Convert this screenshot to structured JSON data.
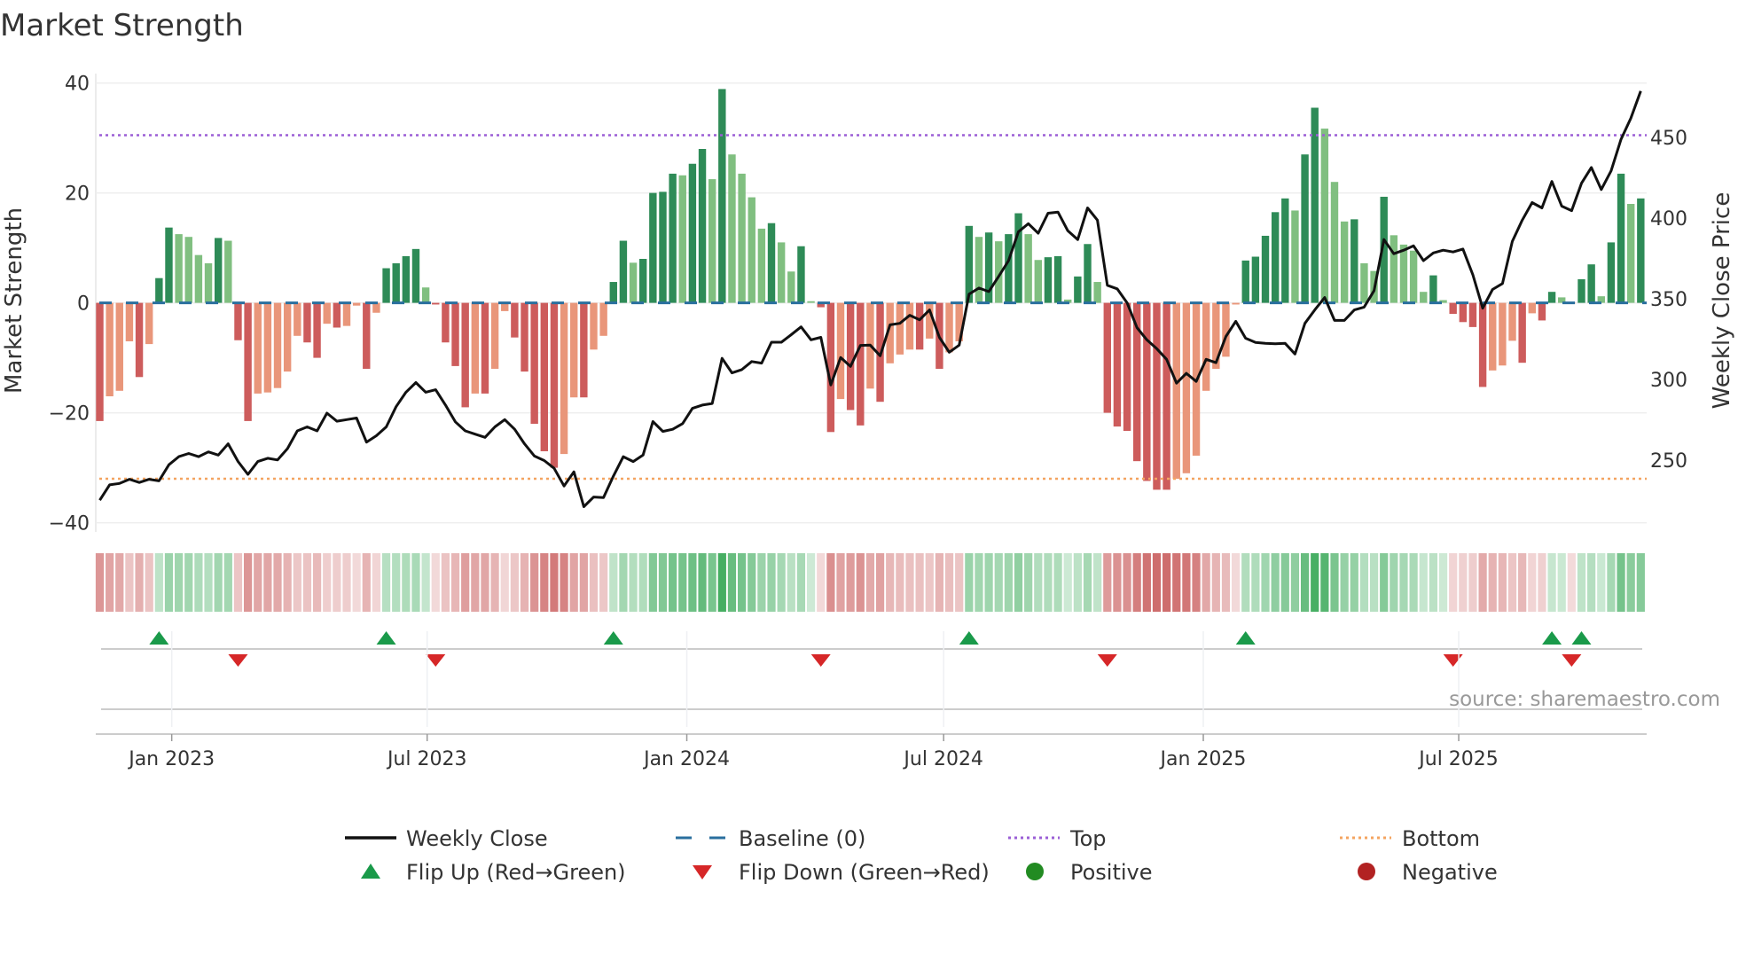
{
  "chart_data": {
    "type": "bar",
    "title": "Market Strength",
    "ylabel": "Market Strength",
    "y2label": "Weekly Close Price",
    "ylim": [
      -42,
      42
    ],
    "yticks": [
      "40",
      "20",
      "0",
      "−20",
      "−40"
    ],
    "ytick_values": [
      40,
      20,
      0,
      -20,
      -40
    ],
    "y2ticks": [
      "450",
      "400",
      "350",
      "300",
      "250"
    ],
    "y2tick_values": [
      450,
      400,
      350,
      300,
      250
    ],
    "x_start": "2022-11-11",
    "x_step_days": 7,
    "xticks": [
      {
        "label": "Jan 2023",
        "date": "2023-01-01"
      },
      {
        "label": "Jul 2023",
        "date": "2023-07-01"
      },
      {
        "label": "Jan 2024",
        "date": "2024-01-01"
      },
      {
        "label": "Jul 2024",
        "date": "2024-07-01"
      },
      {
        "label": "Jan 2025",
        "date": "2025-01-01"
      },
      {
        "label": "Jul 2025",
        "date": "2025-07-01"
      }
    ],
    "top_level": 30.5,
    "bottom_level": -32,
    "baseline": 0,
    "strength": [
      -21.5,
      -17,
      -16,
      -7,
      -13.5,
      -7.5,
      4.5,
      13.7,
      12.5,
      12,
      8.7,
      7.2,
      11.8,
      11.3,
      -6.8,
      -21.5,
      -16.5,
      -16.3,
      -15.5,
      -12.5,
      -6,
      -7.2,
      -10,
      -3.8,
      -4.5,
      -4.2,
      -0.5,
      -12,
      -1.8,
      6.3,
      7.2,
      8.5,
      9.8,
      2.8,
      -0.3,
      -7.2,
      -11.5,
      -19,
      -16.5,
      -16.5,
      -12,
      -1.5,
      -6.3,
      -12.5,
      -22,
      -27,
      -30,
      -27.5,
      -17.2,
      -17.2,
      -8.5,
      -6,
      3.8,
      11.3,
      7.3,
      8,
      20,
      20.2,
      23.5,
      23.2,
      25.3,
      28,
      22.5,
      38.9,
      27,
      23.5,
      19.2,
      13.5,
      14.5,
      11,
      5.7,
      10.3,
      0.3,
      -0.8,
      -23.5,
      -17.5,
      -19.5,
      -22.3,
      -15.6,
      -18,
      -11,
      -9.4,
      -8.5,
      -8.5,
      -6.5,
      -12,
      -9,
      -7,
      14,
      12,
      12.8,
      11.2,
      12.5,
      16.3,
      12.5,
      7.8,
      8.3,
      8.5,
      0.6,
      4.8,
      10.7,
      3.8,
      -20,
      -22.5,
      -23.3,
      -28.8,
      -32.4,
      -34,
      -34,
      -32,
      -31,
      -27.8,
      -16,
      -12,
      -9.8,
      -0.3,
      7.7,
      8.4,
      12.2,
      16.5,
      19,
      16.8,
      27,
      35.5,
      31.7,
      22,
      14.8,
      15.2,
      7.2,
      5.8,
      19.3,
      12.3,
      10.6,
      9.5,
      2,
      5,
      0.5,
      -2,
      -3.5,
      -4.4,
      -15.3,
      -12.3,
      -11.4,
      -6.9,
      -10.9,
      -1.9,
      -3.2,
      2,
      1,
      -0.1,
      4.3,
      7,
      1.2,
      11,
      23.5,
      18,
      19
    ],
    "weekly_close": [
      225,
      234.5,
      235.4,
      238,
      236,
      238,
      237,
      247,
      252,
      254,
      252,
      255,
      253,
      260,
      249,
      241,
      249,
      251,
      250,
      257,
      268,
      270.5,
      268,
      279,
      274,
      275,
      276,
      261,
      265,
      270.5,
      283,
      292,
      298,
      292,
      293.5,
      284,
      273.6,
      268,
      266,
      264,
      270.5,
      275,
      269,
      260,
      252.4,
      249.6,
      244.8,
      233.8,
      242.6,
      221,
      227,
      226.6,
      240,
      252,
      249,
      253,
      273.8,
      267.7,
      269,
      272.5,
      282,
      284,
      285,
      313,
      304,
      306,
      311,
      310,
      323,
      323,
      327.7,
      332.5,
      324.5,
      326,
      296.5,
      313.5,
      308,
      321,
      321.2,
      314.6,
      333.8,
      334.7,
      339.7,
      336.9,
      343,
      326,
      316.8,
      321.2,
      352.8,
      356.6,
      354.4,
      363.8,
      373.6,
      391.5,
      396.5,
      390.6,
      403,
      403.7,
      392.1,
      386.7,
      406.3,
      398.7,
      358.3,
      356.1,
      347.4,
      332.1,
      324.5,
      319,
      312.4,
      297.6,
      303.7,
      298.7,
      312.4,
      310.3,
      326.6,
      336,
      325.5,
      322.9,
      322.3,
      322,
      322.3,
      315.7,
      334.7,
      343,
      350.7,
      336.5,
      336.5,
      343,
      344.8,
      355,
      386.7,
      377.9,
      380.1,
      382.8,
      373.6,
      378.4,
      380.1,
      379,
      380.8,
      364.8,
      344.1,
      355.7,
      359.4,
      385.6,
      398.7,
      409.6,
      406.3,
      422.7,
      407.4,
      404.6,
      421.6,
      431.4,
      417.7,
      429.3,
      448.9,
      462,
      478.8
    ],
    "legend": {
      "placement": "bottom",
      "items": [
        {
          "label": "Weekly Close",
          "kind": "line"
        },
        {
          "label": "Baseline (0)",
          "kind": "dash"
        },
        {
          "label": "Top",
          "kind": "dot-top"
        },
        {
          "label": "Bottom",
          "kind": "dot-bottom"
        },
        {
          "label": "Flip Up (Red→Green)",
          "kind": "tri-up"
        },
        {
          "label": "Flip Down (Green→Red)",
          "kind": "tri-down"
        },
        {
          "label": "Positive",
          "kind": "dot-pos"
        },
        {
          "label": "Negative",
          "kind": "dot-neg"
        }
      ]
    },
    "source": "source: sharemaestro.com"
  },
  "colors": {
    "green_strong": "#2e8b57",
    "green_weak": "#80bf80",
    "red_strong": "#cd5c5c",
    "red_weak": "#e9967a",
    "close": "#111111",
    "baseline": "#2a6f9e",
    "top": "#9b5fd6",
    "bottom": "#f4a460",
    "flip_up": "#1a9a4a",
    "flip_down": "#d62728",
    "positive": "#228b22",
    "negative": "#b22222"
  }
}
